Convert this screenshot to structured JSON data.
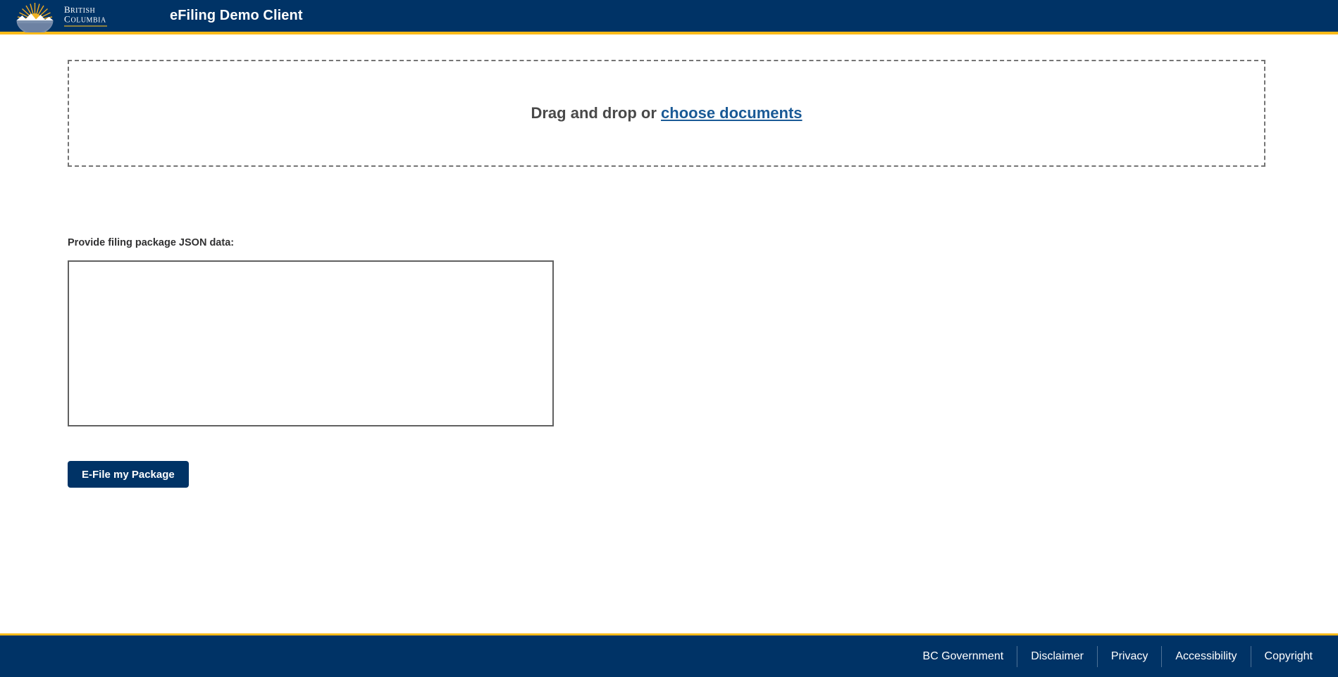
{
  "colors": {
    "brand_navy": "#003366",
    "brand_gold": "#fcba19",
    "link_blue": "#1a5a96",
    "body_text": "#313132",
    "dropzone_border": "#747474"
  },
  "header": {
    "logo_name": "bc-government-logo",
    "logo_line1": "BRITISH",
    "logo_line2": "COLUMBIA",
    "app_title": "eFiling Demo Client"
  },
  "main": {
    "dropzone": {
      "prompt": "Drag and drop or",
      "link_label": "choose documents"
    },
    "json_form": {
      "label": "Provide filing package JSON data:",
      "value": "",
      "placeholder": ""
    },
    "submit": {
      "label": "E-File my Package"
    }
  },
  "footer": {
    "links": [
      {
        "label": "BC Government"
      },
      {
        "label": "Disclaimer"
      },
      {
        "label": "Privacy"
      },
      {
        "label": "Accessibility"
      },
      {
        "label": "Copyright"
      }
    ]
  }
}
